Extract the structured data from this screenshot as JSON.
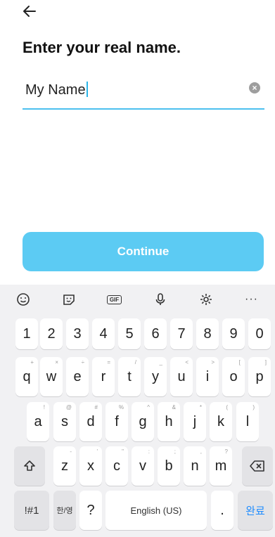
{
  "header": {
    "title": "Enter your real name."
  },
  "name_field": {
    "value": "My Name"
  },
  "continue_label": "Continue",
  "keyboard": {
    "toolbar": [
      "emoji-icon",
      "sticker-icon",
      "gif-icon",
      "mic-icon",
      "settings-icon",
      "more-icon"
    ],
    "gif_label": "GIF",
    "more_label": "···",
    "numbers": [
      "1",
      "2",
      "3",
      "4",
      "5",
      "6",
      "7",
      "8",
      "9",
      "0"
    ],
    "row1": [
      [
        "q",
        "+"
      ],
      [
        "w",
        "×"
      ],
      [
        "e",
        "÷"
      ],
      [
        "r",
        "="
      ],
      [
        "t",
        "/"
      ],
      [
        "y",
        "_"
      ],
      [
        "u",
        "<"
      ],
      [
        "i",
        ">"
      ],
      [
        "o",
        "["
      ],
      [
        "p",
        "]"
      ]
    ],
    "row2": [
      [
        "a",
        "!"
      ],
      [
        "s",
        "@"
      ],
      [
        "d",
        "#"
      ],
      [
        "f",
        "%"
      ],
      [
        "g",
        "^"
      ],
      [
        "h",
        "&"
      ],
      [
        "j",
        "*"
      ],
      [
        "k",
        "("
      ],
      [
        "l",
        ")"
      ]
    ],
    "row3": [
      [
        "z",
        "-"
      ],
      [
        "x",
        "'"
      ],
      [
        "c",
        "\""
      ],
      [
        "v",
        ":"
      ],
      [
        "b",
        ";"
      ],
      [
        "n",
        ","
      ],
      [
        "m",
        "?"
      ]
    ],
    "symbols_label": "!#1",
    "lang_switch_label": "한/영",
    "question_label": "?",
    "space_label": "English (US)",
    "period_label": ".",
    "done_label": "완료"
  }
}
